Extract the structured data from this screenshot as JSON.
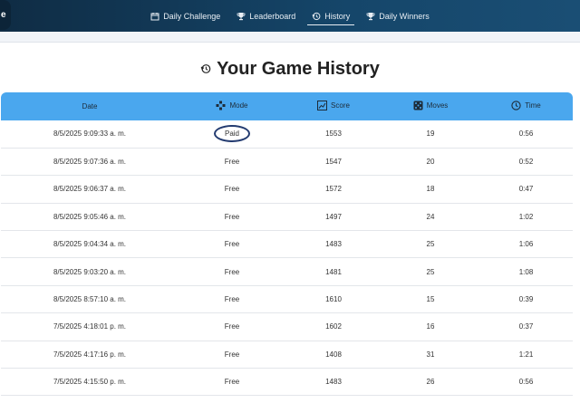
{
  "brand": {
    "label": "e"
  },
  "nav": {
    "items": [
      {
        "label": "Daily Challenge",
        "icon": "calendar-icon",
        "active": false
      },
      {
        "label": "Leaderboard",
        "icon": "trophy-icon",
        "active": false
      },
      {
        "label": "History",
        "icon": "history-icon",
        "active": true
      },
      {
        "label": "Daily Winners",
        "icon": "trophy-icon",
        "active": false
      }
    ]
  },
  "page": {
    "title": "Your Game History",
    "title_icon": "history-icon"
  },
  "table": {
    "header_color": "#4aa7ee",
    "columns": [
      {
        "label": "Date",
        "icon": ""
      },
      {
        "label": "Mode",
        "icon": "gamepad-icon"
      },
      {
        "label": "Score",
        "icon": "chart-icon"
      },
      {
        "label": "Moves",
        "icon": "dice-icon"
      },
      {
        "label": "Time",
        "icon": "clock-icon"
      }
    ],
    "rows": [
      {
        "date": "8/5/2025 9:09:33 a. m.",
        "mode": "Paid",
        "score": "1553",
        "moves": "19",
        "time": "0:56"
      },
      {
        "date": "8/5/2025 9:07:36 a. m.",
        "mode": "Free",
        "score": "1547",
        "moves": "20",
        "time": "0:52"
      },
      {
        "date": "8/5/2025 9:06:37 a. m.",
        "mode": "Free",
        "score": "1572",
        "moves": "18",
        "time": "0:47"
      },
      {
        "date": "8/5/2025 9:05:46 a. m.",
        "mode": "Free",
        "score": "1497",
        "moves": "24",
        "time": "1:02"
      },
      {
        "date": "8/5/2025 9:04:34 a. m.",
        "mode": "Free",
        "score": "1483",
        "moves": "25",
        "time": "1:06"
      },
      {
        "date": "8/5/2025 9:03:20 a. m.",
        "mode": "Free",
        "score": "1481",
        "moves": "25",
        "time": "1:08"
      },
      {
        "date": "8/5/2025 8:57:10 a. m.",
        "mode": "Free",
        "score": "1610",
        "moves": "15",
        "time": "0:39"
      },
      {
        "date": "7/5/2025 4:18:01 p. m.",
        "mode": "Free",
        "score": "1602",
        "moves": "16",
        "time": "0:37"
      },
      {
        "date": "7/5/2025 4:17:16 p. m.",
        "mode": "Free",
        "score": "1408",
        "moves": "31",
        "time": "1:21"
      },
      {
        "date": "7/5/2025 4:15:50 p. m.",
        "mode": "Free",
        "score": "1483",
        "moves": "26",
        "time": "0:56"
      }
    ]
  }
}
